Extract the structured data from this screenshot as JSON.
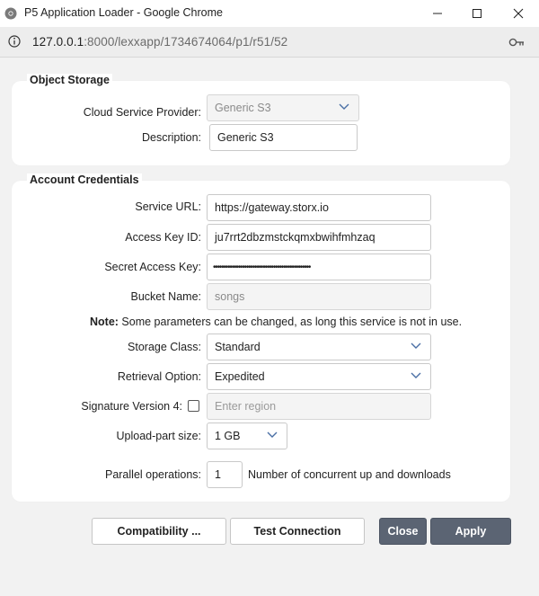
{
  "window": {
    "title": "P5 Application Loader - Google Chrome",
    "url_host": "127.0.0.1",
    "url_path": ":8000/lexxapp/1734674064/p1/r51/52"
  },
  "object_storage": {
    "legend": "Object Storage",
    "provider_label": "Cloud Service Provider:",
    "provider_value": "Generic S3",
    "description_label": "Description:",
    "description_value": "Generic S3"
  },
  "credentials": {
    "legend": "Account Credentials",
    "service_url_label": "Service URL:",
    "service_url_value": "https://gateway.storx.io",
    "access_key_label": "Access Key ID:",
    "access_key_value": "ju7rrt2dbzmstckqmxbwihfmhzaq",
    "secret_key_label": "Secret Access Key:",
    "secret_key_value": "•••••••••••••••••••••••••••••••••••••••••••••••",
    "bucket_label": "Bucket Name:",
    "bucket_value": "songs",
    "note_bold": "Note:",
    "note_text": " Some parameters can be changed, as long this service is not in use.",
    "storage_class_label": "Storage Class:",
    "storage_class_value": "Standard",
    "retrieval_label": "Retrieval Option:",
    "retrieval_value": "Expedited",
    "sigv4_label": "Signature Version 4:",
    "sigv4_checked": false,
    "region_placeholder": "Enter region",
    "upload_part_label": "Upload-part size:",
    "upload_part_value": "1 GB",
    "parallel_label": "Parallel operations:",
    "parallel_value": "1",
    "parallel_hint": "Number of concurrent up and downloads"
  },
  "buttons": {
    "compatibility": "Compatibility ...",
    "test_connection": "Test Connection",
    "close": "Close",
    "apply": "Apply"
  },
  "colors": {
    "primary_button": "#5b6473"
  }
}
